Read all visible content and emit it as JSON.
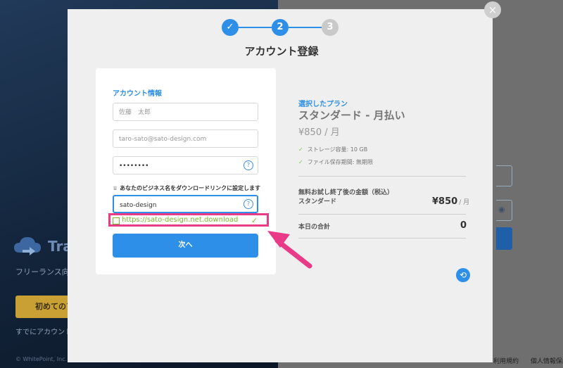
{
  "background": {
    "brand": "Tra",
    "subtitle": "フリーランス向け",
    "cta": "初めてのア",
    "login": "すでにアカウント",
    "copyright": "© WhitePoint, Inc. All Rights Reserved.",
    "footer_links": [
      "利用規約",
      "個人情報保護方"
    ]
  },
  "close_icon": "×",
  "stepper": {
    "steps": [
      "✓",
      "2",
      "3"
    ],
    "active": 2
  },
  "title": "アカウント登録",
  "form": {
    "section_label": "アカウント情報",
    "name_placeholder": "佐藤　太郎",
    "email_placeholder": "taro-sato@sato-design.com",
    "password_value": "••••••••",
    "business_label": "あなたのビジネス名をダウンロードリンクに設定します",
    "business_value": "sato-design",
    "download_url": "https://sato-design.net.download",
    "next_label": "次へ",
    "help_icon": "?"
  },
  "plan": {
    "label": "選択したプラン",
    "name": "スタンダード - 月払い",
    "price": "¥850 / 月",
    "features": [
      "ストレージ容量: 10 GB",
      "ファイル保存期間: 無期限"
    ],
    "trial_label_line1": "無料お試し終了後の金額（税込）",
    "trial_label_line2": "スタンダード",
    "trial_price": "¥850",
    "trial_unit": "/ 月",
    "total_label": "本日の合計",
    "total_value": "0"
  },
  "colors": {
    "accent": "#2e8fe8",
    "success": "#6fba2c",
    "highlight": "#e83a86"
  }
}
